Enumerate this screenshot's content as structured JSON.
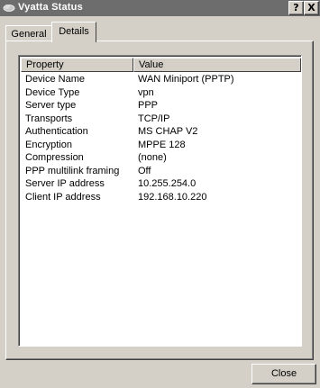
{
  "window": {
    "title": "Vyatta Status",
    "help_glyph": "?",
    "close_glyph": "X"
  },
  "tabs": [
    {
      "label": "General",
      "active": false
    },
    {
      "label": "Details",
      "active": true
    }
  ],
  "details": {
    "columns": {
      "property": "Property",
      "value": "Value"
    },
    "rows": [
      {
        "property": "Device Name",
        "value": "WAN Miniport (PPTP)"
      },
      {
        "property": "Device Type",
        "value": "vpn"
      },
      {
        "property": "Server type",
        "value": "PPP"
      },
      {
        "property": "Transports",
        "value": "TCP/IP"
      },
      {
        "property": "Authentication",
        "value": "MS CHAP V2"
      },
      {
        "property": "Encryption",
        "value": "MPPE 128"
      },
      {
        "property": "Compression",
        "value": "(none)"
      },
      {
        "property": "PPP multilink framing",
        "value": "Off"
      },
      {
        "property": "Server IP address",
        "value": "10.255.254.0"
      },
      {
        "property": "Client IP address",
        "value": "192.168.10.220"
      }
    ]
  },
  "buttons": {
    "close": "Close"
  },
  "icons": {
    "title": "network-cloud-icon",
    "help": "help-icon",
    "close": "close-icon"
  }
}
